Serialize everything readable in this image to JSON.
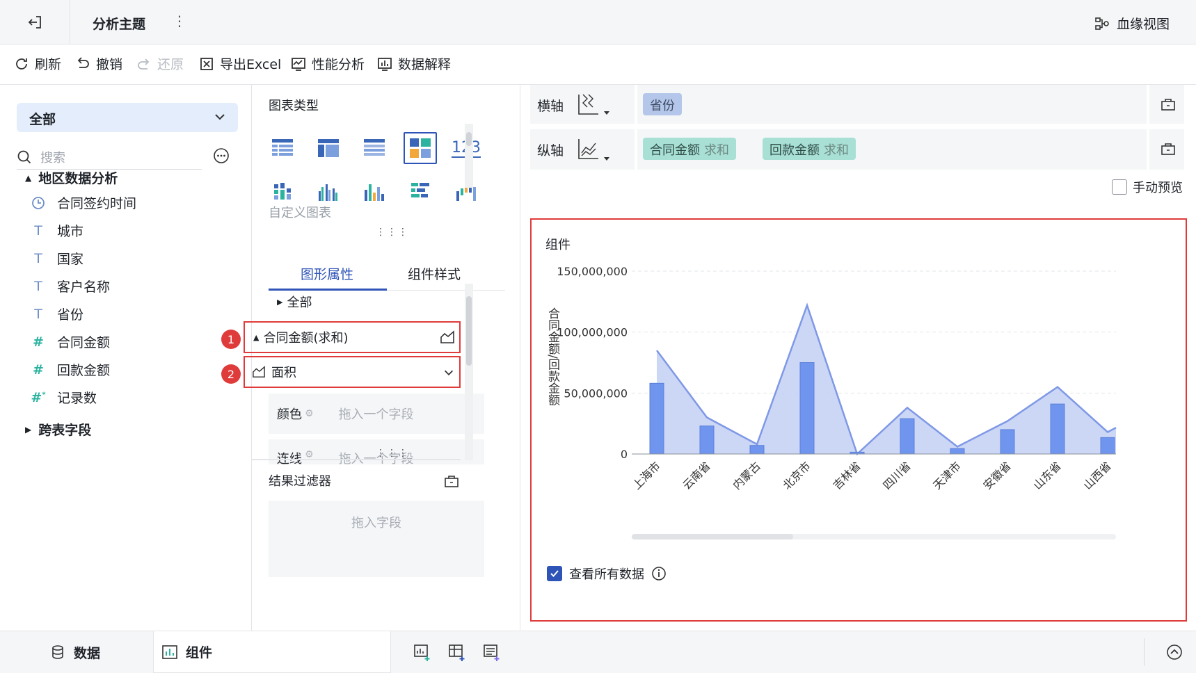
{
  "topbar": {
    "title": "分析主题",
    "more": "⋮",
    "lineage_label": "血缘视图"
  },
  "toolbar": {
    "refresh": "刷新",
    "undo": "撤销",
    "redo": "还原",
    "export": "导出Excel",
    "performance": "性能分析",
    "explain": "数据解释"
  },
  "left": {
    "scope": "全部",
    "search_placeholder": "搜索",
    "groups": [
      {
        "label": "地区数据分析"
      },
      {
        "label": "跨表字段"
      }
    ],
    "fields": [
      {
        "label": "合同签约时间",
        "icon": "clock-icon"
      },
      {
        "label": "城市",
        "icon": "text-icon"
      },
      {
        "label": "国家",
        "icon": "text-icon"
      },
      {
        "label": "客户名称",
        "icon": "text-icon"
      },
      {
        "label": "省份",
        "icon": "text-icon"
      },
      {
        "label": "合同金额",
        "icon": "hash-icon"
      },
      {
        "label": "回款金额",
        "icon": "hash-icon"
      },
      {
        "label": "记录数",
        "icon": "hash-star-icon"
      }
    ]
  },
  "middle": {
    "chart_type_title": "图表类型",
    "kpi_label": "123",
    "custom_chart": "自定义图表",
    "tabs": [
      "图形属性",
      "组件样式"
    ],
    "all_label": "全部",
    "measure_label": "合同金额(求和)",
    "shape_label": "面积",
    "badges": [
      "1",
      "2"
    ],
    "color_label": "颜色",
    "line_label": "连线",
    "drop_hint": "拖入一个字段",
    "filter_title": "结果过滤器",
    "filter_hint": "拖入字段"
  },
  "right": {
    "x_axis_label": "横轴",
    "y_axis_label": "纵轴",
    "x_fields": [
      {
        "name": "省份"
      }
    ],
    "y_fields": [
      {
        "name": "合同金额",
        "agg": "求和"
      },
      {
        "name": "回款金额",
        "agg": "求和"
      }
    ],
    "manual_preview": "手动预览",
    "chart_title": "组件",
    "view_all": "查看所有数据"
  },
  "chart_data": {
    "type": "bar",
    "ylabel": "合同金额/回款金额",
    "ylim": [
      0,
      150000000
    ],
    "yticks": [
      "150,000,000",
      "100,000,000",
      "50,000,000",
      "0"
    ],
    "categories": [
      "上海市",
      "云南省",
      "内蒙古",
      "北京市",
      "吉林省",
      "四川省",
      "天津市",
      "安徽省",
      "山东省",
      "山西省"
    ],
    "series": [
      {
        "name": "合同金额",
        "kind": "area",
        "values": [
          85000000,
          30000000,
          8000000,
          122000000,
          0,
          38000000,
          6000000,
          27000000,
          55000000,
          18000000
        ]
      },
      {
        "name": "回款金额",
        "kind": "bar",
        "values": [
          58000000,
          23000000,
          7000000,
          75000000,
          1500000,
          29000000,
          4500000,
          20000000,
          41000000,
          13500000
        ]
      }
    ],
    "colors": {
      "area_fill": "#c3d0f5",
      "area_line": "#7f98e6",
      "bar": "#7095ee"
    }
  },
  "bottom": {
    "data_tab": "数据",
    "widget_tab": "组件"
  }
}
